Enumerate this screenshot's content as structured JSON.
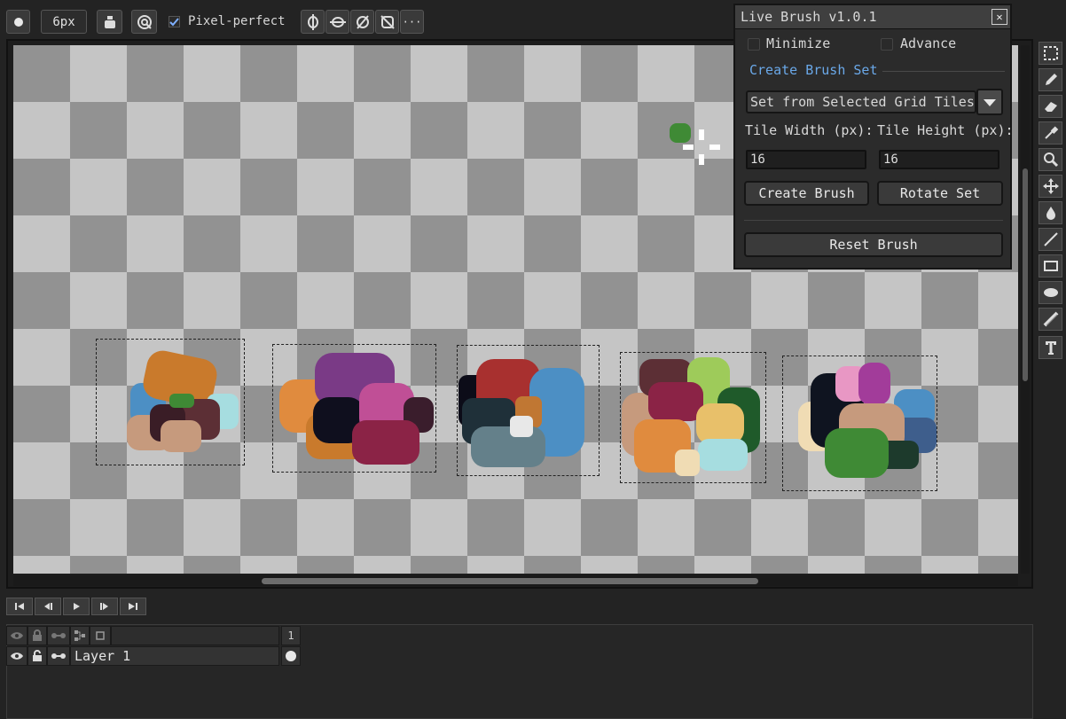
{
  "toolbar": {
    "brush_size": "6px",
    "pixel_perfect_label": "Pixel-perfect",
    "more_label": "···"
  },
  "panel": {
    "title": "Live Brush v1.0.1",
    "close_glyph": "✕",
    "minimize_label": "Minimize",
    "advance_label": "Advance",
    "section_title": "Create Brush Set",
    "dropdown_value": "Set from Selected Grid Tiles",
    "tile_width_label": "Tile Width (px):",
    "tile_height_label": "Tile Height (px):",
    "tile_width_value": "16",
    "tile_height_value": "16",
    "create_brush_label": "Create Brush",
    "rotate_set_label": "Rotate Set",
    "reset_brush_label": "Reset Brush"
  },
  "timeline": {
    "frame_number": "1"
  },
  "layers": {
    "layer_name": "Layer 1"
  },
  "colors": {
    "accent_link": "#6aa8e8",
    "cursor_green": "#3f8a35",
    "checker_light": "#c5c5c5",
    "checker_dark": "#929292"
  }
}
